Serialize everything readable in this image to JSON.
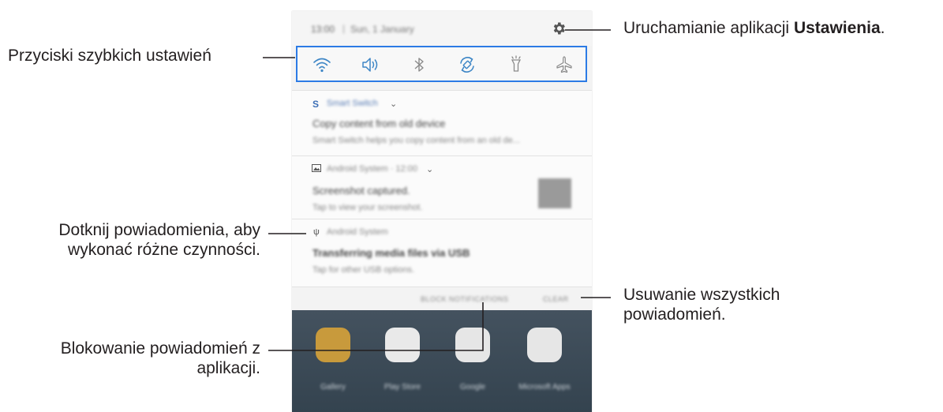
{
  "status_bar": {
    "time": "13:00",
    "separator": "|",
    "date": "Sun, 1 January"
  },
  "quick_settings": [
    {
      "name": "wifi-icon"
    },
    {
      "name": "sound-icon"
    },
    {
      "name": "bluetooth-icon"
    },
    {
      "name": "auto-rotate-icon"
    },
    {
      "name": "flashlight-icon"
    },
    {
      "name": "airplane-mode-icon"
    }
  ],
  "notifications": [
    {
      "app": "Smart Switch",
      "title": "Copy content from old device",
      "body": "Smart Switch helps you copy content from an old de..."
    },
    {
      "app": "Android System · 12:00",
      "title": "Screenshot captured.",
      "body": "Tap to view your screenshot."
    },
    {
      "app": "Android System",
      "title": "Transferring media files via USB",
      "body": "Tap for other USB options."
    }
  ],
  "actions": {
    "block": "BLOCK NOTIFICATIONS",
    "clear": "CLEAR"
  },
  "home_apps": [
    "Gallery",
    "Play Store",
    "Google",
    "Microsoft Apps"
  ],
  "callouts": {
    "settings_prefix": "Uruchamianie aplikacji ",
    "settings_bold": "Ustawienia",
    "settings_suffix": ".",
    "quick_buttons": "Przyciski szybkich ustawień",
    "tap_line1": "Dotknij powiadomienia, aby",
    "tap_line2": "wykonać różne czynności.",
    "clear_line1": "Usuwanie wszystkich",
    "clear_line2": "powiadomień.",
    "block_line1": "Blokowanie powiadomień z",
    "block_line2": "aplikacji."
  },
  "colors": {
    "accent": "#2c7be5",
    "callout_line": "#231f20"
  }
}
